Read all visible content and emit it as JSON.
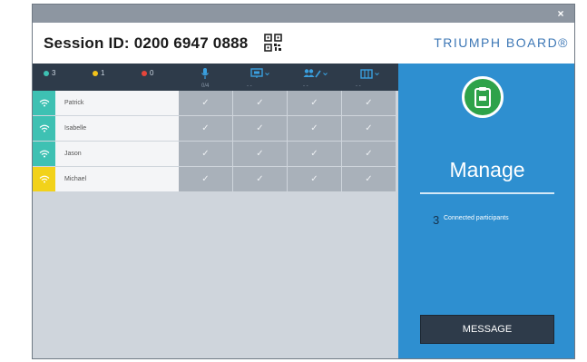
{
  "window": {
    "close_label": "×"
  },
  "header": {
    "session_label": "Session ID: 0200 6947 0888",
    "brand": "TRIUMPH BOARD®"
  },
  "toolbar": {
    "status_counts": [
      {
        "value": "3",
        "color": "#3ec1b3"
      },
      {
        "value": "1",
        "color": "#f2c21a"
      },
      {
        "value": "0",
        "color": "#e5453b"
      }
    ],
    "column_icons": [
      "microphone-icon",
      "screen-share-icon",
      "users-edit-icon",
      "layout-icon"
    ],
    "column_subs": [
      "0/4",
      "-  -",
      "-  -",
      "-  -"
    ]
  },
  "participants": [
    {
      "name": "Patrick",
      "status_color": "#3ec1b3"
    },
    {
      "name": "Isabelle",
      "status_color": "#3ec1b3"
    },
    {
      "name": "Jason",
      "status_color": "#3ec1b3"
    },
    {
      "name": "Michael",
      "status_color": "#f2d21a"
    }
  ],
  "cell_mark": "✓",
  "panel": {
    "title": "Manage",
    "connected_count": "3",
    "connected_label": "Connected participants",
    "message_button": "MESSAGE",
    "icon": "clipboard-icon"
  }
}
